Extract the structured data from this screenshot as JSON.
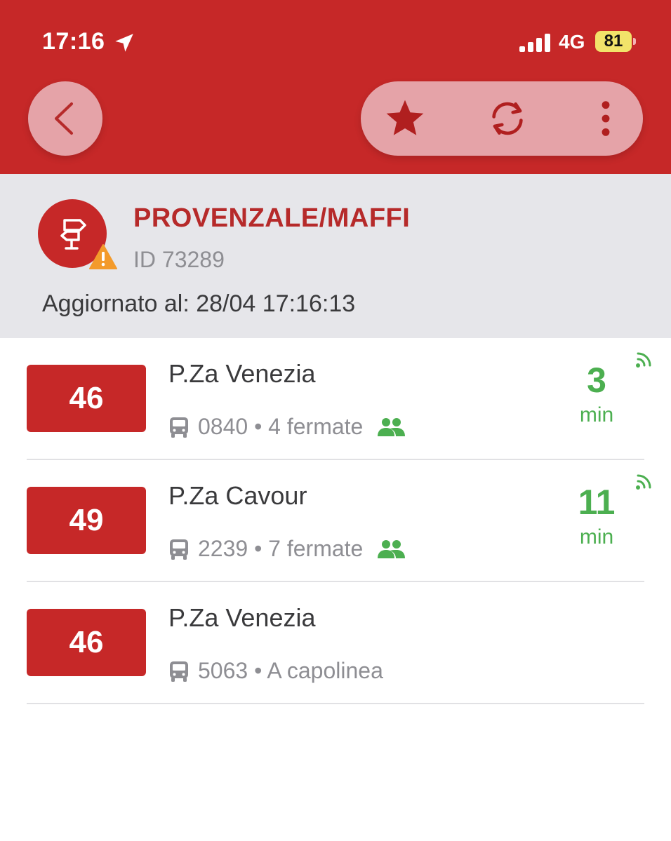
{
  "status_bar": {
    "time": "17:16",
    "network": "4G",
    "battery": "81"
  },
  "colors": {
    "brand": "#c62828",
    "eta_green": "#4caf50"
  },
  "toolbar": {
    "back_icon": "chevron-left-icon",
    "favorite_icon": "star-icon",
    "refresh_icon": "refresh-icon",
    "more_icon": "more-vertical-icon"
  },
  "stop": {
    "name": "PROVENZALE/MAFFI",
    "id": "ID 73289",
    "updated": "Aggiornato al: 28/04 17:16:13"
  },
  "arrivals": [
    {
      "line": "46",
      "destination": "P.Za Venezia",
      "vehicle": "0840",
      "info": "• 4 fermate",
      "eta": "3",
      "eta_unit": "min"
    },
    {
      "line": "49",
      "destination": "P.Za Cavour",
      "vehicle": "2239",
      "info": "• 7 fermate",
      "eta": "11",
      "eta_unit": "min"
    },
    {
      "line": "46",
      "destination": "P.Za Venezia",
      "vehicle": "5063",
      "info": "• A capolinea"
    }
  ]
}
